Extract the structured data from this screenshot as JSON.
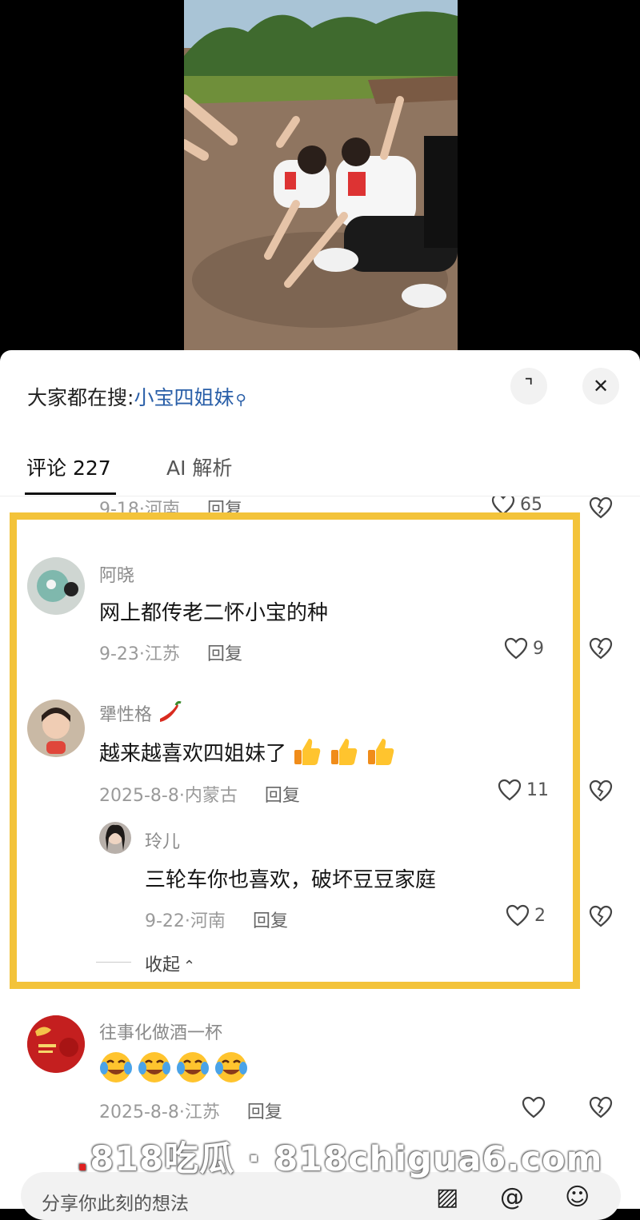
{
  "search": {
    "prefix": "大家都在搜:",
    "keyword": "小宝四姐妹"
  },
  "tabs": {
    "comments": "评论 227",
    "ai": "AI 解析"
  },
  "partial_row": {
    "meta": "9-18·河南",
    "reply": "回复",
    "likes": "65"
  },
  "comments": [
    {
      "user": "阿晓",
      "text": "网上都传老二怀小宝的种",
      "meta": "9-23·江苏",
      "reply": "回复",
      "likes": "9"
    },
    {
      "user": "犟性格",
      "text": "越来越喜欢四姐妹了",
      "meta": "2025-8-8·内蒙古",
      "reply": "回复",
      "likes": "11"
    },
    {
      "user": "玲儿",
      "text": "三轮车你也喜欢，破坏豆豆家庭",
      "meta": "9-22·河南",
      "reply": "回复",
      "likes": "2"
    },
    {
      "user": "往事化做酒一杯",
      "text": "",
      "meta": "2025-8-8·江苏",
      "reply": "回复",
      "likes": ""
    }
  ],
  "collapse": "收起",
  "watermark": {
    "dot": ".",
    "text": "818吃瓜 · 818chigua6.com"
  },
  "input": {
    "placeholder": "分享你此刻的想法"
  },
  "colors": {
    "highlight": "#f3c33a",
    "keyword": "#2a5fa8"
  }
}
